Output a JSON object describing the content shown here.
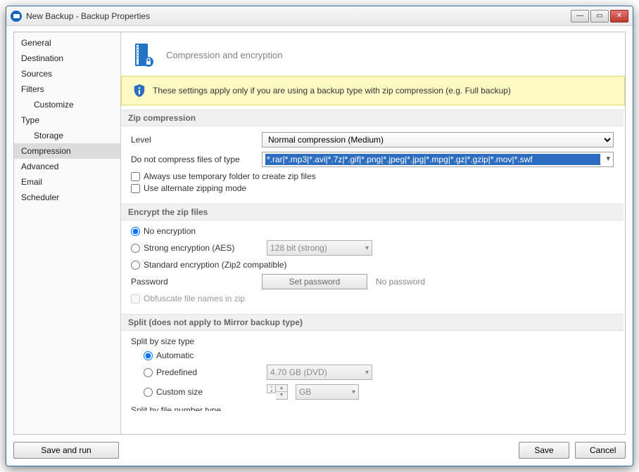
{
  "window": {
    "title": "New Backup - Backup Properties"
  },
  "sidebar": {
    "items": [
      {
        "label": "General",
        "sub": false,
        "selected": false
      },
      {
        "label": "Destination",
        "sub": false,
        "selected": false
      },
      {
        "label": "Sources",
        "sub": false,
        "selected": false
      },
      {
        "label": "Filters",
        "sub": false,
        "selected": false
      },
      {
        "label": "Customize",
        "sub": true,
        "selected": false
      },
      {
        "label": "Type",
        "sub": false,
        "selected": false
      },
      {
        "label": "Storage",
        "sub": true,
        "selected": false
      },
      {
        "label": "Compression",
        "sub": false,
        "selected": true
      },
      {
        "label": "Advanced",
        "sub": false,
        "selected": false
      },
      {
        "label": "Email",
        "sub": false,
        "selected": false
      },
      {
        "label": "Scheduler",
        "sub": false,
        "selected": false
      }
    ]
  },
  "header": {
    "title": "Compression and encryption"
  },
  "banner": {
    "text": "These settings apply only if you are using a backup type with zip compression (e.g. Full backup)"
  },
  "sections": {
    "zip": {
      "title": "Zip compression",
      "level_label": "Level",
      "level_value": "Normal compression (Medium)",
      "exclude_label": "Do not compress files of type",
      "exclude_value": "*.rar|*.mp3|*.avi|*.7z|*.gif|*.png|*.jpeg|*.jpg|*.mpg|*.gz|*.gzip|*.mov|*.swf",
      "temp_folder_label": "Always use temporary folder to create zip files",
      "alt_mode_label": "Use alternate zipping mode"
    },
    "encrypt": {
      "title": "Encrypt the zip files",
      "opt_none": "No encryption",
      "opt_aes": "Strong encryption (AES)",
      "aes_bits": "128 bit (strong)",
      "opt_zip2": "Standard encryption (Zip2 compatible)",
      "password_label": "Password",
      "set_password_btn": "Set password",
      "password_status": "No password",
      "obfuscate_label": "Obfuscate file names in zip"
    },
    "split": {
      "title": "Split (does not apply to Mirror backup type)",
      "size_type_label": "Split by size type",
      "opt_auto": "Automatic",
      "opt_predef": "Predefined",
      "predef_value": "4.70 GB (DVD)",
      "opt_custom": "Custom size",
      "custom_value": "2",
      "custom_unit": "GB",
      "file_num_label": "Split by file number type"
    }
  },
  "footer": {
    "save_run": "Save and run",
    "save": "Save",
    "cancel": "Cancel"
  }
}
